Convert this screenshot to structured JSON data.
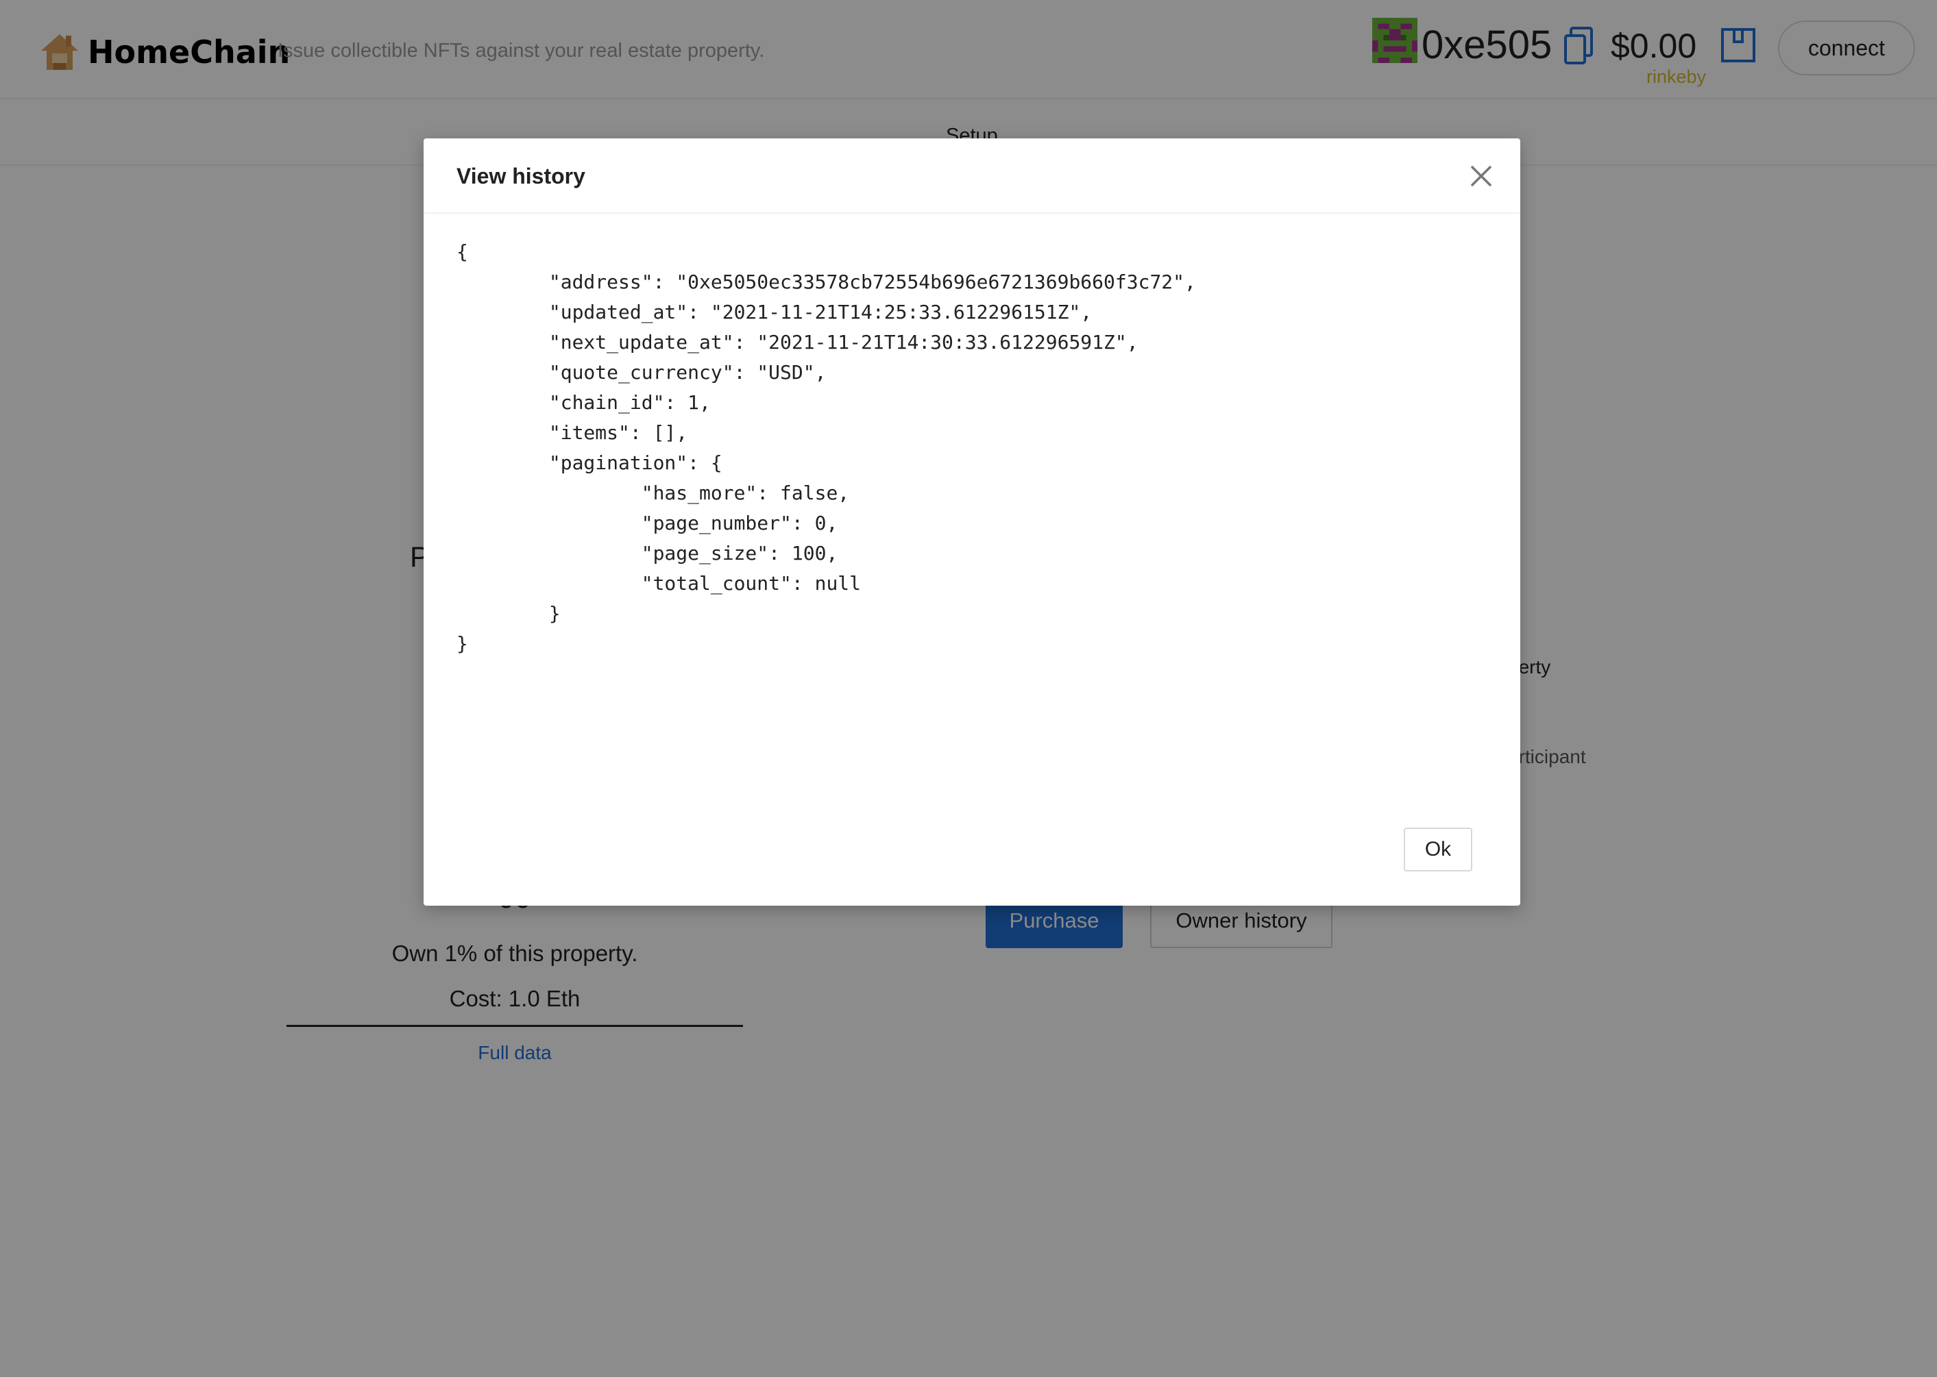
{
  "header": {
    "brand": "HomeChain",
    "tagline": "Issue collectible NFTs against your real estate property.",
    "account": "0xe505",
    "balance": "$0.00",
    "network": "rinkeby",
    "connect_label": "connect",
    "icons": [
      "house-logo-icon",
      "identicon-avatar",
      "copy-icon",
      "wallet-icon"
    ],
    "colors": {
      "network": "#d6b92e",
      "accent": "#1f6ed4"
    }
  },
  "tabs": {
    "setup": "Setup"
  },
  "background": {
    "left_letter": "P",
    "right_text_1": "perty",
    "right_text_2": "articipant",
    "card": {
      "title": "90",
      "own": "Own 1% of this property.",
      "cost": "Cost: 1.0 Eth",
      "full_data": "Full data"
    },
    "purchase_label": "Purchase",
    "owner_history_label": "Owner history"
  },
  "modal": {
    "title": "View history",
    "json": "{\n\t\"address\": \"0xe5050ec33578cb72554b696e6721369b660f3c72\",\n\t\"updated_at\": \"2021-11-21T14:25:33.612296151Z\",\n\t\"next_update_at\": \"2021-11-21T14:30:33.612296591Z\",\n\t\"quote_currency\": \"USD\",\n\t\"chain_id\": 1,\n\t\"items\": [],\n\t\"pagination\": {\n\t\t\"has_more\": false,\n\t\t\"page_number\": 0,\n\t\t\"page_size\": 100,\n\t\t\"total_count\": null\n\t}\n}",
    "ok_label": "Ok",
    "close_icon": "close-icon"
  }
}
